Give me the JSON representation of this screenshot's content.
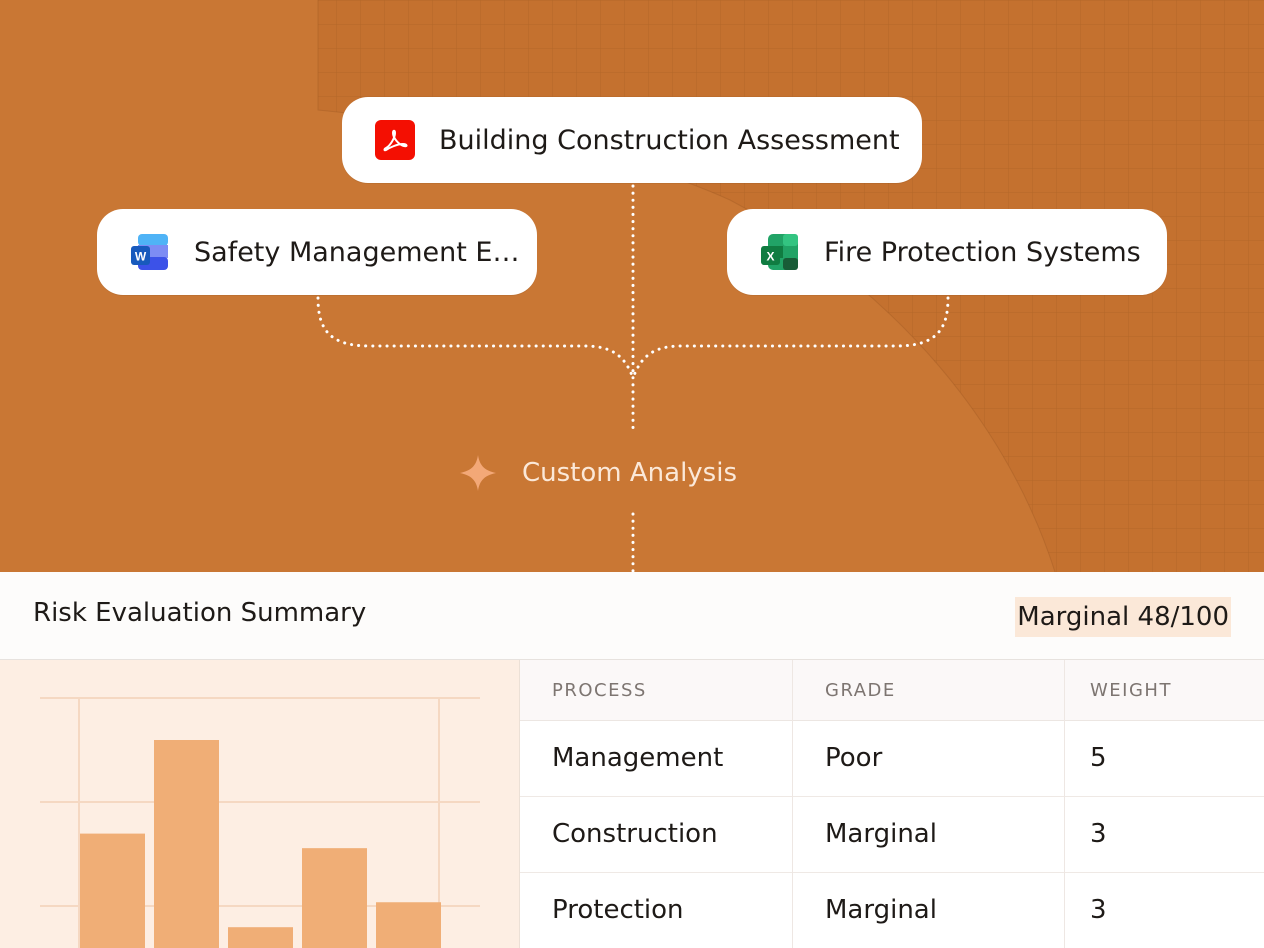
{
  "sources": {
    "building": {
      "label": "Building Construction Assessment",
      "icon": "pdf-icon",
      "color": "#f40f02"
    },
    "safety": {
      "label": "Safety Management E…",
      "icon": "word-icon",
      "color": "#185abd"
    },
    "fire": {
      "label": "Fire Protection Systems",
      "icon": "excel-icon",
      "color": "#107c41"
    }
  },
  "analysis": {
    "label": "Custom Analysis",
    "icon": "sparkle-icon",
    "color": "#f3a877"
  },
  "summary": {
    "title": "Risk Evaluation Summary",
    "score": "Marginal 48/100"
  },
  "table": {
    "headers": [
      "PROCESS",
      "GRADE",
      "WEIGHT"
    ],
    "rows": [
      {
        "process": "Management",
        "grade": "Poor",
        "weight": "5"
      },
      {
        "process": "Construction",
        "grade": "Marginal",
        "weight": "3"
      },
      {
        "process": "Protection",
        "grade": "Marginal",
        "weight": "3"
      }
    ]
  },
  "colors": {
    "hero": "#c97734",
    "accent": "#f0ae76",
    "chart_bg": "#fdeee3"
  },
  "chart_data": {
    "type": "bar",
    "values": [
      0.55,
      1.0,
      0.1,
      0.48,
      0.22
    ],
    "value_unit": "relative bar height (fraction of tallest visible bar)"
  }
}
